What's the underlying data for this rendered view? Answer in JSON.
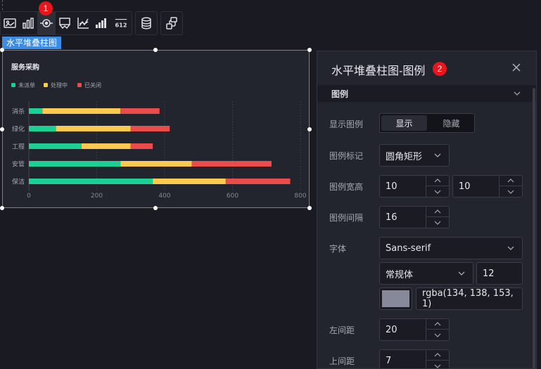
{
  "toolbar": {
    "icons": [
      "image-icon",
      "bar-chart-icon",
      "target-icon",
      "flag-chart-icon",
      "line-chart-icon",
      "stepped-bar-icon",
      "number-612-icon",
      "database-icon",
      "share-link-icon"
    ],
    "number_label": "612"
  },
  "badges": {
    "one": "1",
    "two": "2"
  },
  "selection": {
    "tag": "水平堆叠柱图"
  },
  "chart_data": {
    "type": "bar",
    "orientation": "horizontal",
    "stacked": true,
    "title": "服务采购",
    "categories": [
      "消杀",
      "绿化",
      "工程",
      "安管",
      "保洁"
    ],
    "series": [
      {
        "name": "未派单",
        "color": "#1ccf93",
        "values": [
          40,
          80,
          155,
          270,
          365
        ]
      },
      {
        "name": "处理中",
        "color": "#fdc94f",
        "values": [
          230,
          220,
          145,
          210,
          215
        ]
      },
      {
        "name": "已关闭",
        "color": "#ea4b4b",
        "values": [
          115,
          115,
          65,
          235,
          190
        ]
      }
    ],
    "xlim": [
      0,
      800
    ],
    "xticks": [
      "0",
      "200",
      "400",
      "600",
      "800"
    ],
    "grid": true,
    "legend": "top-left"
  },
  "panel": {
    "title": "水平堆叠柱图-图例",
    "section": "图例",
    "rows": {
      "show_legend": {
        "label": "显示图例",
        "on": "显示",
        "off": "隐藏"
      },
      "legend_mark": {
        "label": "图例标记",
        "value": "圆角矩形"
      },
      "legend_size": {
        "label": "图例宽高",
        "width": "10",
        "height": "10"
      },
      "legend_gap": {
        "label": "图例间隔",
        "value": "16"
      },
      "font": {
        "label": "字体",
        "family": "Sans-serif",
        "weight": "常规体",
        "size": "12",
        "color_text": "rgba(134, 138, 153, 1)",
        "color": "#86899a"
      },
      "left_margin": {
        "label": "左间距",
        "value": "20"
      },
      "top_margin": {
        "label": "上间距",
        "value": "7"
      }
    }
  }
}
